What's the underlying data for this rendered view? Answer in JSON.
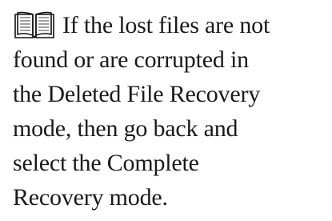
{
  "note": {
    "icon": "open-book-icon",
    "lines": [
      "If the lost files are not",
      "found or are corrupted in",
      "the Deleted File Recovery",
      "mode, then go back and",
      "select the Complete",
      "Recovery mode."
    ]
  }
}
